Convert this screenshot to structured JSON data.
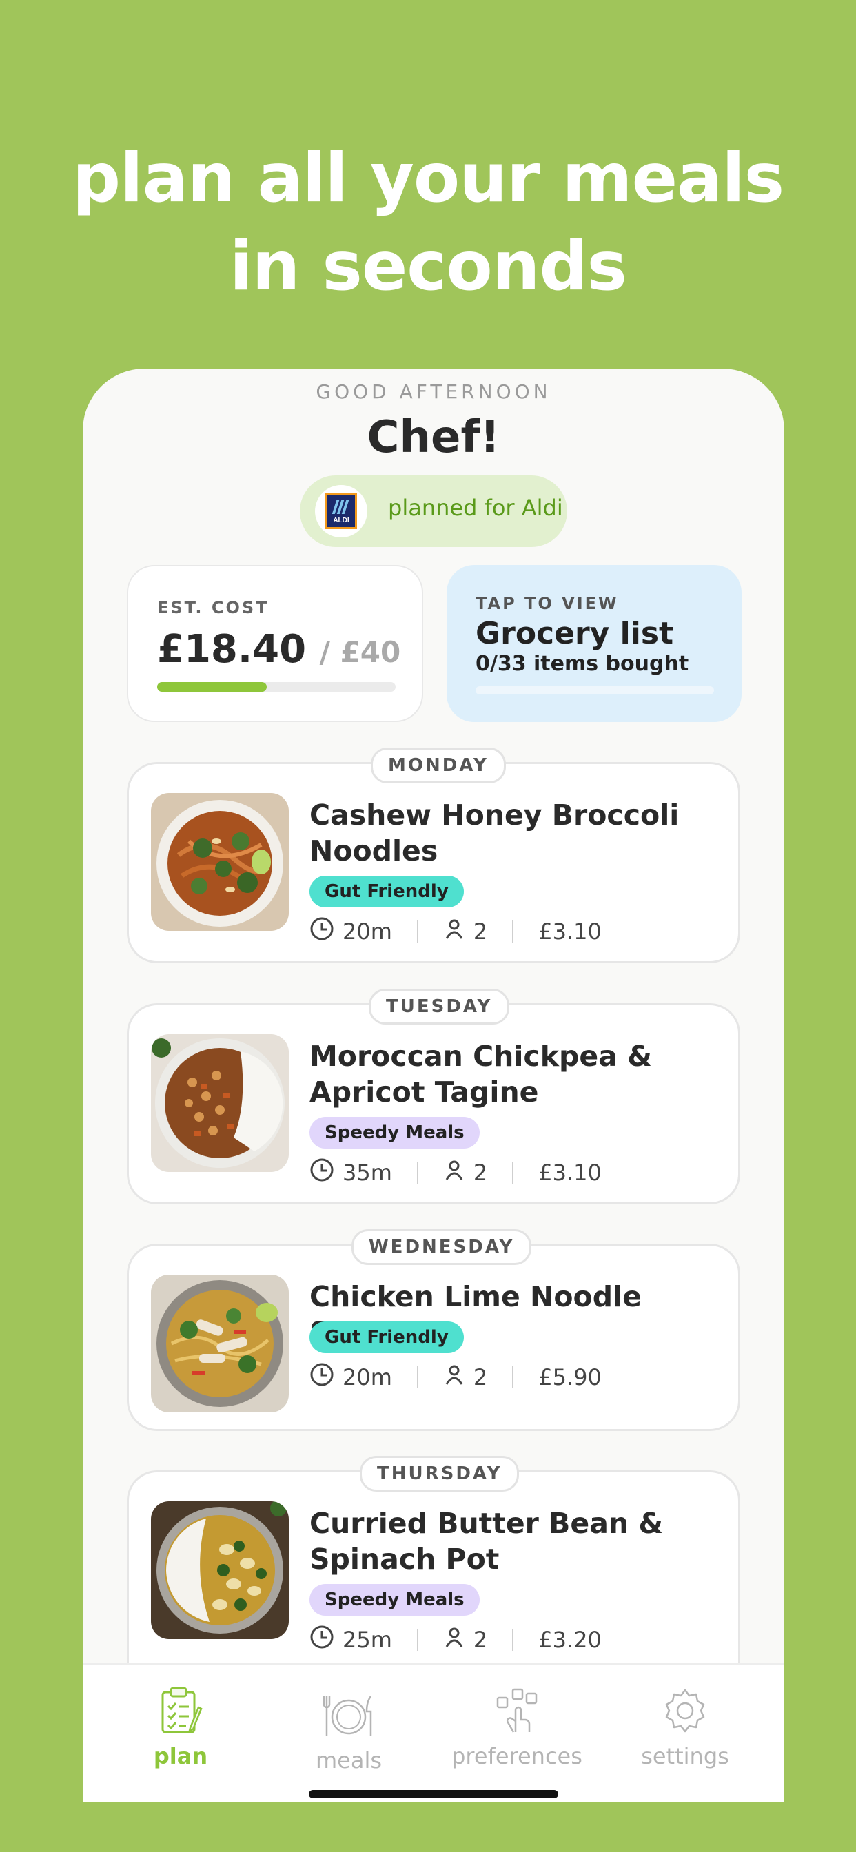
{
  "headline": {
    "line1": "plan all your meals",
    "line2": "in seconds"
  },
  "greeting": {
    "subtitle": "GOOD AFTERNOON",
    "name": "Chef!"
  },
  "store": {
    "logo_text": "ALDI",
    "label": "planned for Aldi"
  },
  "cost": {
    "label": "EST. COST",
    "value": "£18.40",
    "budget": "/ £40",
    "progress_fraction": 0.46
  },
  "grocery": {
    "label": "TAP TO VIEW",
    "title": "Grocery list",
    "status": "0/33 items bought",
    "progress_fraction": 0
  },
  "meals": [
    {
      "day": "MONDAY",
      "title": "Cashew Honey Broccoli Noodles",
      "tag": "Gut Friendly",
      "time": "20m",
      "servings": "2",
      "price": "£3.10"
    },
    {
      "day": "TUESDAY",
      "title": "Moroccan Chickpea & Apricot Tagine",
      "tag": "Speedy Meals",
      "time": "35m",
      "servings": "2",
      "price": "£3.10"
    },
    {
      "day": "WEDNESDAY",
      "title": "Chicken Lime Noodle Soup",
      "tag": "Gut Friendly",
      "time": "20m",
      "servings": "2",
      "price": "£5.90"
    },
    {
      "day": "THURSDAY",
      "title": "Curried Butter Bean & Spinach Pot",
      "tag": "Speedy Meals",
      "time": "25m",
      "servings": "2",
      "price": "£3.20"
    }
  ],
  "tabs": [
    {
      "label": "plan",
      "icon": "clipboard-check-icon",
      "active": true
    },
    {
      "label": "meals",
      "icon": "plate-cutlery-icon"
    },
    {
      "label": "preferences",
      "icon": "tap-preferences-icon"
    },
    {
      "label": "settings",
      "icon": "gear-icon"
    }
  ],
  "colors": {
    "background": "#a0c55a",
    "accent": "#8ec63a",
    "gut_tag": "#4fe0cf",
    "speedy_tag": "#e1d6fb",
    "grocery_card": "#ddeffb"
  }
}
